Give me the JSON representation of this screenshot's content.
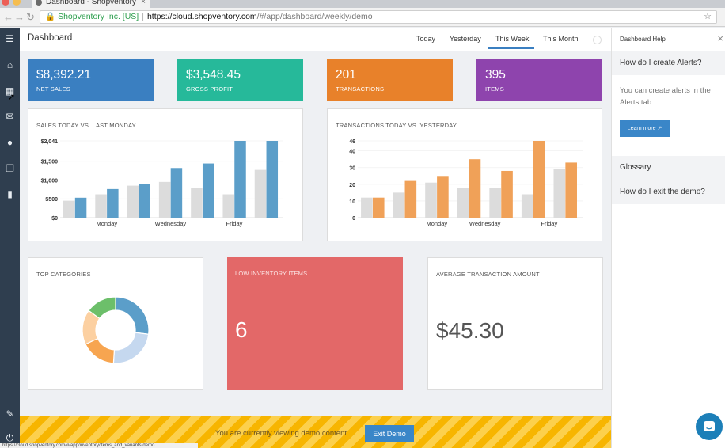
{
  "browser": {
    "tab_title": "Dashboard - Shopventory",
    "tab_close": "×",
    "cert_owner": "Shopventory Inc. [US]",
    "url_host": "https://cloud.shopventory.com",
    "url_path": "/#/app/dashboard/weekly/demo",
    "status_url": "https://cloud.shopventory.com/#/app/inventory/items_and_variants/demo"
  },
  "dashboard": {
    "title": "Dashboard",
    "ranges": [
      "Today",
      "Yesterday",
      "This Week",
      "This Month"
    ],
    "active_range": "This Week"
  },
  "stats": [
    {
      "value": "$8,392.21",
      "label": "NET SALES",
      "color": "#3a7fc1"
    },
    {
      "value": "$3,548.45",
      "label": "GROSS PROFIT",
      "color": "#26b99a"
    },
    {
      "value": "201",
      "label": "TRANSACTIONS",
      "color": "#e8812a"
    },
    {
      "value": "395",
      "label": "ITEMS",
      "color": "#8e44ad"
    }
  ],
  "panels": {
    "top_categories": "TOP CATEGORIES",
    "low_inventory_title": "LOW INVENTORY ITEMS",
    "low_inventory_value": "6",
    "avg_transaction_title": "AVERAGE TRANSACTION AMOUNT",
    "avg_transaction_value": "$45.30"
  },
  "chart_data": [
    {
      "type": "bar",
      "title": "SALES TODAY VS. LAST MONDAY",
      "yticks": [
        "$0",
        "$500",
        "$1,000",
        "$1,500",
        "$2,041"
      ],
      "ytick_values": [
        0,
        500,
        1000,
        1500,
        2041
      ],
      "ylim": [
        0,
        2041
      ],
      "xticks": [
        {
          "label": "Monday",
          "index": 1
        },
        {
          "label": "Wednesday",
          "index": 3
        },
        {
          "label": "Friday",
          "index": 5
        }
      ],
      "series": [
        {
          "values": [
            450,
            620,
            850,
            950,
            790,
            620,
            1270
          ],
          "color": "#dcdcdc"
        },
        {
          "values": [
            530,
            760,
            900,
            1320,
            1440,
            2041,
            2041
          ],
          "color": "#5b9ec9"
        }
      ]
    },
    {
      "type": "bar",
      "title": "TRANSACTIONS TODAY VS. YESTERDAY",
      "yticks": [
        "0",
        "10",
        "20",
        "30",
        "40",
        "46"
      ],
      "ytick_values": [
        0,
        10,
        20,
        30,
        40,
        46
      ],
      "ylim": [
        0,
        46
      ],
      "xticks": [
        {
          "label": "Monday",
          "index": 2
        },
        {
          "label": "Wednesday",
          "index": 3.5
        },
        {
          "label": "Friday",
          "index": 5.5
        }
      ],
      "series": [
        {
          "values": [
            12,
            15,
            21,
            18,
            18,
            14,
            29
          ],
          "color": "#dcdcdc"
        },
        {
          "values": [
            12,
            22,
            25,
            35,
            28,
            46,
            33
          ],
          "color": "#f0a158"
        }
      ]
    },
    {
      "type": "pie",
      "title": "TOP CATEGORIES",
      "slices": [
        {
          "value": 27,
          "color": "#5b9ec9"
        },
        {
          "value": 24,
          "color": "#c5d8ef"
        },
        {
          "value": 17,
          "color": "#f7a550"
        },
        {
          "value": 17,
          "color": "#fcd0a1"
        },
        {
          "value": 15,
          "color": "#6cbf6a"
        }
      ]
    }
  ],
  "banner": {
    "text": "You are currently viewing demo content.",
    "button": "Exit Demo"
  },
  "help": {
    "title": "Dashboard Help",
    "close": "×",
    "question_1": "How do I create Alerts?",
    "answer_1": "You can create alerts in the Alerts tab.",
    "link": "Learn more",
    "glossary": "Glossary",
    "question_2": "How do I exit the demo?"
  },
  "colors": {
    "low_inventory_bg": "#e36868",
    "sidebar_bg": "#2f3e4f",
    "accent": "#3a86c8"
  }
}
